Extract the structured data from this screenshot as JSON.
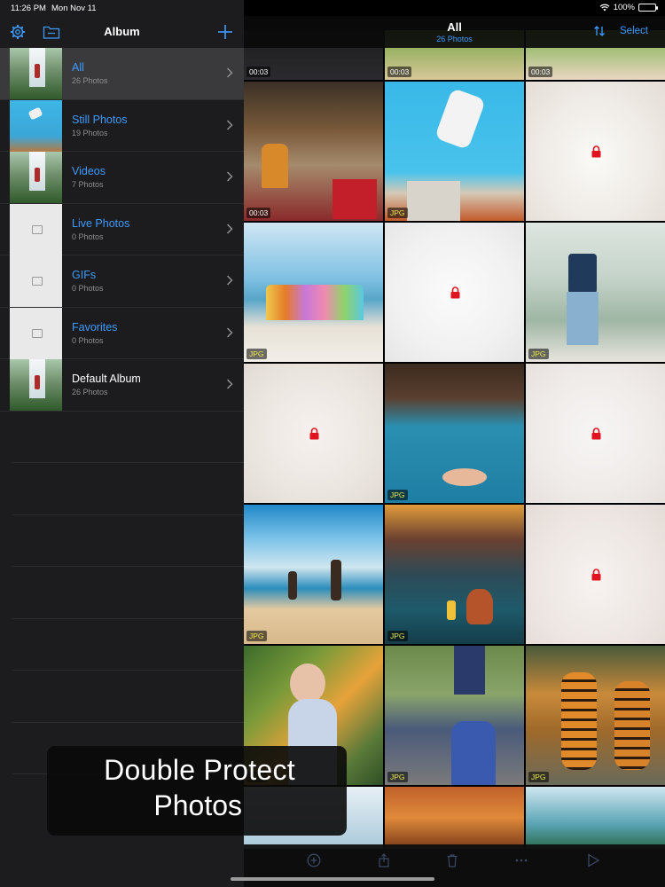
{
  "status_bar": {
    "time": "11:26 PM",
    "date": "Mon Nov 11",
    "battery": "100%"
  },
  "sidebar": {
    "title": "Album",
    "icons": [
      "gear-icon",
      "folder-icon",
      "plus-icon"
    ],
    "albums": [
      {
        "name": "All",
        "count": "26 Photos",
        "selected": true,
        "thumb": "waterfall"
      },
      {
        "name": "Still Photos",
        "count": "19 Photos",
        "thumb": "still"
      },
      {
        "name": "Videos",
        "count": "7 Photos",
        "thumb": "waterfall"
      },
      {
        "name": "Live Photos",
        "count": "0 Photos",
        "thumb": "placeholder"
      },
      {
        "name": "GIFs",
        "count": "0 Photos",
        "thumb": "placeholder"
      },
      {
        "name": "Favorites",
        "count": "0 Photos",
        "thumb": "placeholder"
      },
      {
        "name": "Default Album",
        "count": "26 Photos",
        "thumb": "waterfall"
      }
    ]
  },
  "main": {
    "title": "All",
    "subtitle": "26 Photos",
    "select_label": "Select",
    "badges": {
      "video_duration": "00:03",
      "jpg": "JPG"
    }
  },
  "promo": {
    "line1": "Double Protect",
    "line2": "Photos"
  },
  "colors": {
    "accent": "#3d9bff",
    "lock": "#e0141e",
    "jpg_badge": "#e8e84a",
    "sidebar_bg": "#1c1c1e"
  }
}
